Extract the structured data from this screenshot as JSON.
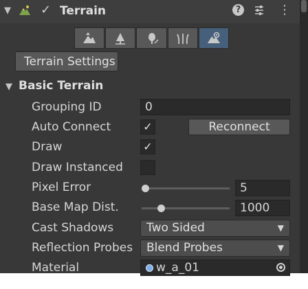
{
  "header": {
    "fold_glyph": "▼",
    "check_glyph": "✓",
    "title": "Terrain",
    "help_glyph": "?",
    "more_glyph": "⋮"
  },
  "toolbar": {
    "tools": [
      {
        "icon": "raise-lower-terrain-icon",
        "active": false
      },
      {
        "icon": "paint-tree-icon",
        "active": false
      },
      {
        "icon": "paint-details-icon",
        "active": false
      },
      {
        "icon": "paint-grass-icon",
        "active": false
      },
      {
        "icon": "terrain-settings-icon",
        "active": true
      }
    ]
  },
  "settings_button_label": "Terrain Settings",
  "basic_terrain": {
    "fold_glyph": "▼",
    "title": "Basic Terrain",
    "grouping_id": {
      "label": "Grouping ID",
      "value": "0"
    },
    "auto_connect": {
      "label": "Auto Connect",
      "checked": "✓",
      "button": "Reconnect"
    },
    "draw": {
      "label": "Draw",
      "checked": "✓"
    },
    "draw_instanced": {
      "label": "Draw Instanced",
      "checked": ""
    },
    "pixel_error": {
      "label": "Pixel Error",
      "value": "5",
      "slider_fraction": 0.0
    },
    "base_map_dist": {
      "label": "Base Map Dist.",
      "value": "1000",
      "slider_fraction": 0.2
    },
    "cast_shadows": {
      "label": "Cast Shadows",
      "value": "Two Sided",
      "arrow": "▼"
    },
    "reflection_probes": {
      "label": "Reflection Probes",
      "value": "Blend Probes",
      "arrow": "▼"
    },
    "material": {
      "label": "Material",
      "value": "w_a_01"
    }
  },
  "colors": {
    "panel_bg": "#383838",
    "field_bg": "#2a2a2a",
    "active_tool": "#46607c",
    "object_icon": "#7fb0ea"
  }
}
